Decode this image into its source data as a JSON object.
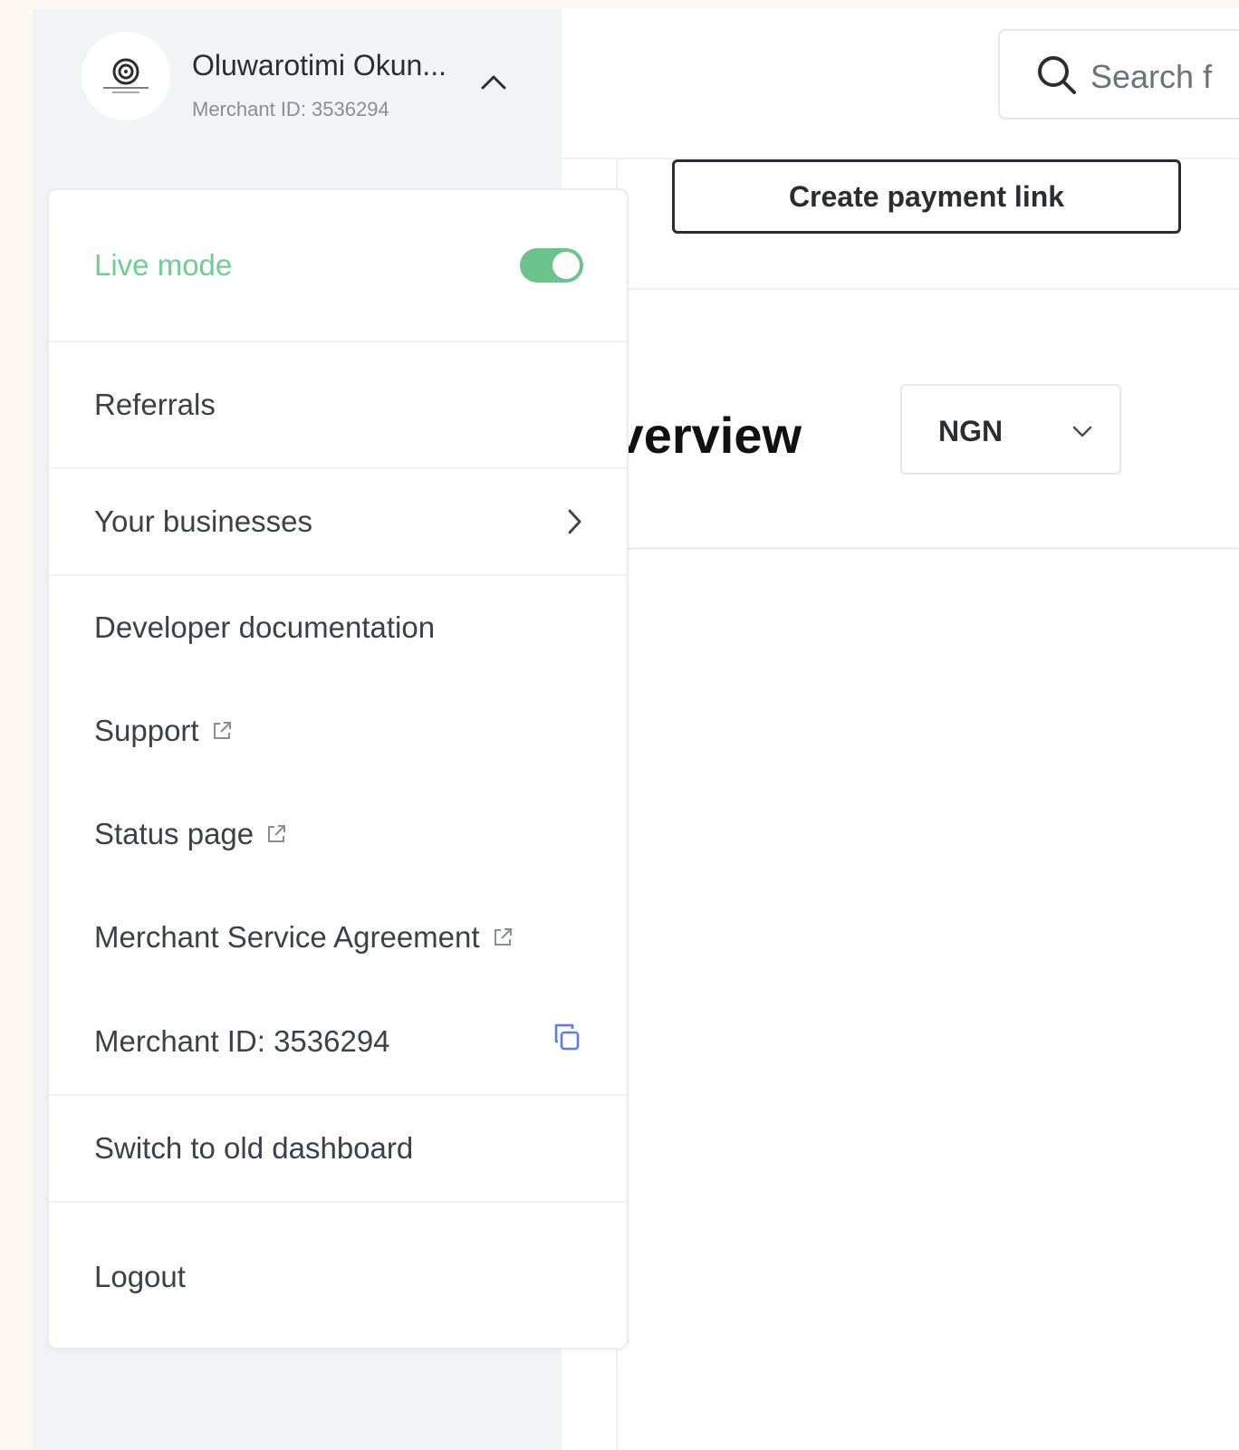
{
  "profile": {
    "name": "Oluwarotimi Okun...",
    "merchant_id": "Merchant ID: 3536294"
  },
  "search": {
    "placeholder": "Search f"
  },
  "actions": {
    "create_payment_link": "Create payment link"
  },
  "overview": {
    "title": "Overview",
    "currency": "NGN"
  },
  "menu": {
    "live_mode": "Live mode",
    "live_mode_on": true,
    "referrals": "Referrals",
    "your_businesses": "Your businesses",
    "developer_documentation": "Developer documentation",
    "support": "Support",
    "status_page": "Status page",
    "merchant_service_agreement": "Merchant Service Agreement",
    "merchant_id": "Merchant ID: 3536294",
    "switch_dashboard": "Switch to old dashboard",
    "logout": "Logout"
  },
  "colors": {
    "live_green": "#6fce92",
    "toggle_green": "#6cc48c",
    "copy_blue": "#5b7cf0",
    "page_background": "#fdf7f1",
    "sidebar_background": "#f2f3f5"
  },
  "icons": [
    "logo-icon",
    "chevron-up-icon",
    "search-icon",
    "chevron-down-icon",
    "chevron-right-icon",
    "external-link-icon",
    "copy-icon"
  ]
}
